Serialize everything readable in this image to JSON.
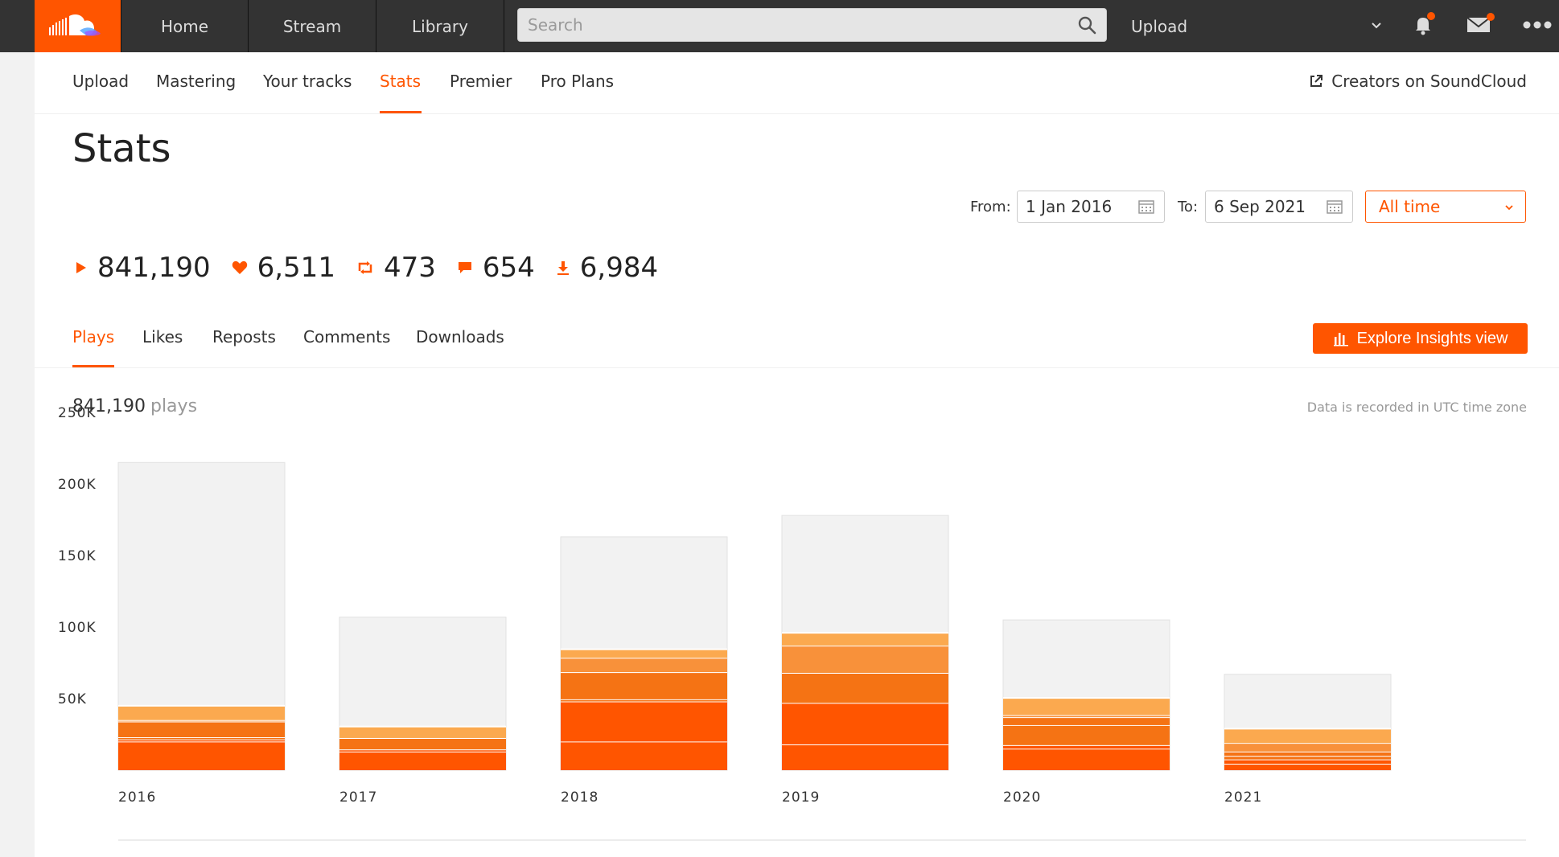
{
  "topbar": {
    "logo": "soundcloud-logo",
    "nav": [
      {
        "label": "Home"
      },
      {
        "label": "Stream"
      },
      {
        "label": "Library"
      }
    ],
    "search_placeholder": "Search",
    "upload_label": "Upload",
    "icons": [
      "chevron-down-icon",
      "bell-icon",
      "mail-icon",
      "more-icon"
    ]
  },
  "subnav": {
    "items": [
      {
        "label": "Upload"
      },
      {
        "label": "Mastering"
      },
      {
        "label": "Your tracks"
      },
      {
        "label": "Stats",
        "active": true
      },
      {
        "label": "Premier"
      },
      {
        "label": "Pro Plans"
      }
    ],
    "creators_label": "Creators on SoundCloud"
  },
  "page": {
    "title": "Stats",
    "from_label": "From:",
    "from_value": "1 Jan 2016",
    "to_label": "To:",
    "to_value": "6 Sep 2021",
    "range_value": "All time"
  },
  "totals": [
    {
      "icon": "play-icon",
      "value": "841,190"
    },
    {
      "icon": "heart-icon",
      "value": "6,511"
    },
    {
      "icon": "repost-icon",
      "value": "473"
    },
    {
      "icon": "comment-icon",
      "value": "654"
    },
    {
      "icon": "download-icon",
      "value": "6,984"
    }
  ],
  "metric_tabs": [
    {
      "label": "Plays",
      "active": true
    },
    {
      "label": "Likes"
    },
    {
      "label": "Reposts"
    },
    {
      "label": "Comments"
    },
    {
      "label": "Downloads"
    }
  ],
  "insights_button": "Explore Insights view",
  "summary": {
    "count": "841,190",
    "unit": "plays",
    "utc_note": "Data is recorded in UTC time zone"
  },
  "colors": {
    "accent": "#ff5500",
    "topbar": "#333333",
    "bar_background": "#f2f2f2",
    "segments": [
      "#ff5500",
      "#f57314",
      "#f8913a",
      "#fba94f"
    ]
  },
  "chart_data": {
    "type": "bar",
    "stacked": true,
    "categories": [
      "2016",
      "2017",
      "2018",
      "2019",
      "2020",
      "2021"
    ],
    "ytick_labels": [
      "250K",
      "200K",
      "150K",
      "100K",
      "50K"
    ],
    "ylim": [
      0,
      250000
    ],
    "totals": [
      215000,
      107000,
      163000,
      178000,
      105000,
      67000
    ],
    "series": [
      {
        "values": [
          20000,
          13000,
          20000,
          18000,
          15000,
          4500
        ]
      },
      {
        "values": [
          1500,
          1500,
          28000,
          29000,
          2500,
          3000
        ]
      },
      {
        "values": [
          1500,
          0,
          1500,
          0,
          14000,
          2500
        ]
      },
      {
        "values": [
          11000,
          8000,
          19000,
          21000,
          5500,
          3000
        ]
      },
      {
        "values": [
          1000,
          0,
          10000,
          19000,
          1500,
          6000
        ]
      },
      {
        "values": [
          10000,
          8000,
          6000,
          9000,
          12000,
          10000
        ]
      }
    ]
  }
}
